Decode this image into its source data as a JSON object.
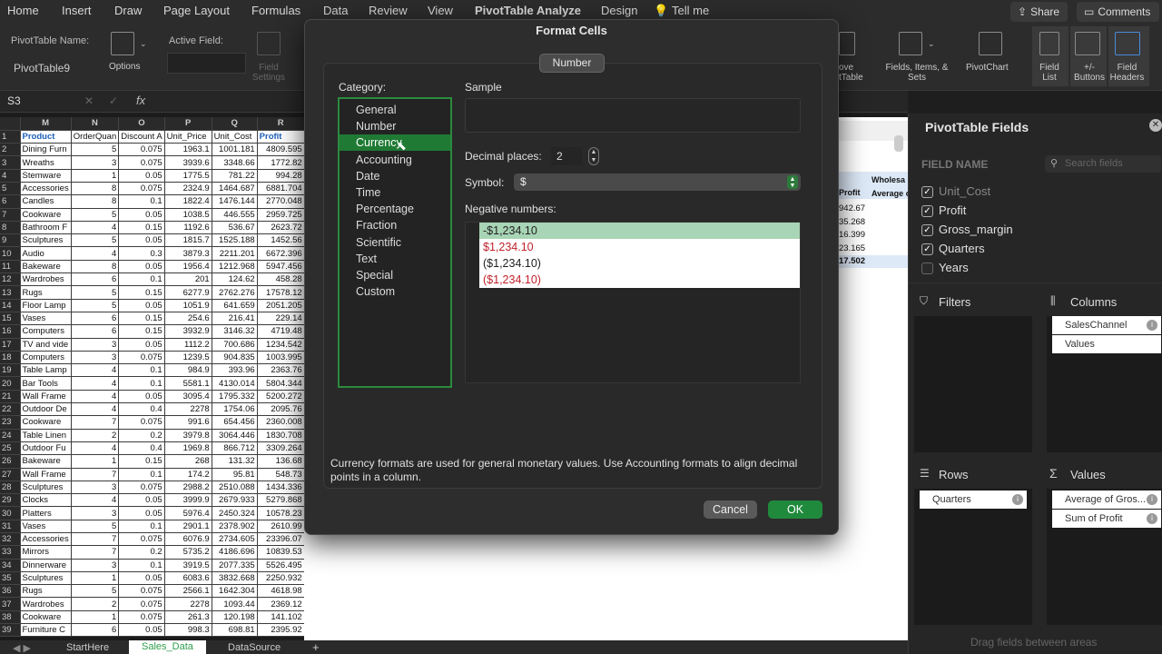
{
  "menu": {
    "items": [
      "Home",
      "Insert",
      "Draw",
      "Page Layout",
      "Formulas",
      "Data",
      "Review",
      "View",
      "PivotTable Analyze",
      "Design",
      "Tell me"
    ],
    "share": "Share",
    "comments": "Comments"
  },
  "ribbon": {
    "pt_name_label": "PivotTable Name:",
    "pt_name_value": "PivotTable9",
    "options": "Options",
    "active_field_label": "Active Field:",
    "field_settings": "Field Settings",
    "move_pt": "ove tTable",
    "fields_items_sets": "Fields, Items, & Sets",
    "pivotchart": "PivotChart",
    "field_list": "Field List",
    "plus_minus": "+/- Buttons",
    "field_headers": "Field Headers"
  },
  "formula_bar": {
    "cell_ref": "S3",
    "fx": "fx",
    "cancel": "✕",
    "confirm": "✓"
  },
  "sheet": {
    "col_headers": [
      "M",
      "N",
      "O",
      "P",
      "Q",
      "R"
    ],
    "header_row": [
      "Product",
      "OrderQuan",
      "Discount A",
      "Unit_Price",
      "Unit_Cost",
      "Profit"
    ],
    "rows": [
      [
        "2",
        "Dining Furn",
        "5",
        "0.075",
        "1963.1",
        "1001.181",
        "4809.595"
      ],
      [
        "3",
        "Wreaths",
        "3",
        "0.075",
        "3939.6",
        "3348.66",
        "1772.82"
      ],
      [
        "4",
        "Stemware",
        "1",
        "0.05",
        "1775.5",
        "781.22",
        "994.28"
      ],
      [
        "5",
        "Accessories",
        "8",
        "0.075",
        "2324.9",
        "1464.687",
        "6881.704"
      ],
      [
        "6",
        "Candles",
        "8",
        "0.1",
        "1822.4",
        "1476.144",
        "2770.048"
      ],
      [
        "7",
        "Cookware",
        "5",
        "0.05",
        "1038.5",
        "446.555",
        "2959.725"
      ],
      [
        "8",
        "Bathroom F",
        "4",
        "0.15",
        "1192.6",
        "536.67",
        "2623.72"
      ],
      [
        "9",
        "Sculptures",
        "5",
        "0.05",
        "1815.7",
        "1525.188",
        "1452.56"
      ],
      [
        "10",
        "Audio",
        "4",
        "0.3",
        "3879.3",
        "2211.201",
        "6672.396"
      ],
      [
        "11",
        "Bakeware",
        "8",
        "0.05",
        "1956.4",
        "1212.968",
        "5947.456"
      ],
      [
        "12",
        "Wardrobes",
        "6",
        "0.1",
        "201",
        "124.62",
        "458.28"
      ],
      [
        "13",
        "Rugs",
        "5",
        "0.15",
        "6277.9",
        "2762.276",
        "17578.12"
      ],
      [
        "14",
        "Floor Lamp",
        "5",
        "0.05",
        "1051.9",
        "641.659",
        "2051.205"
      ],
      [
        "15",
        "Vases",
        "6",
        "0.15",
        "254.6",
        "216.41",
        "229.14"
      ],
      [
        "16",
        "Computers",
        "6",
        "0.15",
        "3932.9",
        "3146.32",
        "4719.48"
      ],
      [
        "17",
        "TV and vide",
        "3",
        "0.05",
        "1112.2",
        "700.686",
        "1234.542"
      ],
      [
        "18",
        "Computers",
        "3",
        "0.075",
        "1239.5",
        "904.835",
        "1003.995"
      ],
      [
        "19",
        "Table Lamp",
        "4",
        "0.1",
        "984.9",
        "393.96",
        "2363.76"
      ],
      [
        "20",
        "Bar Tools",
        "4",
        "0.1",
        "5581.1",
        "4130.014",
        "5804.344"
      ],
      [
        "21",
        "Wall Frame",
        "4",
        "0.05",
        "3095.4",
        "1795.332",
        "5200.272"
      ],
      [
        "22",
        "Outdoor De",
        "4",
        "0.4",
        "2278",
        "1754.06",
        "2095.76"
      ],
      [
        "23",
        "Cookware",
        "7",
        "0.075",
        "991.6",
        "654.456",
        "2360.008"
      ],
      [
        "24",
        "Table Linen",
        "2",
        "0.2",
        "3979.8",
        "3064.446",
        "1830.708"
      ],
      [
        "25",
        "Outdoor Fu",
        "4",
        "0.4",
        "1969.8",
        "866.712",
        "3309.264"
      ],
      [
        "26",
        "Bakeware",
        "1",
        "0.15",
        "268",
        "131.32",
        "136.68"
      ],
      [
        "27",
        "Wall Frame",
        "7",
        "0.1",
        "174.2",
        "95.81",
        "548.73"
      ],
      [
        "28",
        "Sculptures",
        "3",
        "0.075",
        "2988.2",
        "2510.088",
        "1434.336"
      ],
      [
        "29",
        "Clocks",
        "4",
        "0.05",
        "3999.9",
        "2679.933",
        "5279.868"
      ],
      [
        "30",
        "Platters",
        "3",
        "0.05",
        "5976.4",
        "2450.324",
        "10578.23"
      ],
      [
        "31",
        "Vases",
        "5",
        "0.1",
        "2901.1",
        "2378.902",
        "2610.99"
      ],
      [
        "32",
        "Accessories",
        "7",
        "0.075",
        "6076.9",
        "2734.605",
        "23396.07"
      ],
      [
        "33",
        "Mirrors",
        "7",
        "0.2",
        "5735.2",
        "4186.696",
        "10839.53"
      ],
      [
        "34",
        "Dinnerware",
        "3",
        "0.1",
        "3919.5",
        "2077.335",
        "5526.495"
      ],
      [
        "35",
        "Sculptures",
        "1",
        "0.05",
        "6083.6",
        "3832.668",
        "2250.932"
      ],
      [
        "36",
        "Rugs",
        "5",
        "0.075",
        "2566.1",
        "1642.304",
        "4618.98"
      ],
      [
        "37",
        "Wardrobes",
        "2",
        "0.075",
        "2278",
        "1093.44",
        "2369.12"
      ],
      [
        "38",
        "Cookware",
        "1",
        "0.075",
        "261.3",
        "120.198",
        "141.102"
      ],
      [
        "39",
        "Furniture C",
        "6",
        "0.05",
        "998.3",
        "698.81",
        "2395.92"
      ]
    ],
    "right_header_profit": "Profit",
    "right_header_wholesale": "Wholesa",
    "right_header_average": "Average o",
    "right_values": [
      "942.67",
      "35.268",
      "16.399",
      "23.165",
      "17.502"
    ]
  },
  "sheet_tabs": [
    "StartHere",
    "Sales_Data",
    "DataSource",
    "+"
  ],
  "pivot": {
    "title": "PivotTable Fields",
    "field_name": "FIELD NAME",
    "search_placeholder": "Search fields",
    "fields": [
      {
        "name": "Unit_Cost",
        "checked": true
      },
      {
        "name": "Profit",
        "checked": true
      },
      {
        "name": "Gross_margin",
        "checked": true
      },
      {
        "name": "Quarters",
        "checked": true
      },
      {
        "name": "Years",
        "checked": false
      }
    ],
    "filters": "Filters",
    "columns": "Columns",
    "columns_items": [
      "SalesChannel",
      "Values"
    ],
    "rows": "Rows",
    "rows_items": [
      "Quarters"
    ],
    "values": "Values",
    "values_items": [
      "Average of Gros...",
      "Sum of Profit"
    ],
    "drag_hint": "Drag fields between areas"
  },
  "dialog": {
    "title": "Format Cells",
    "tab": "Number",
    "category_label": "Category:",
    "categories": [
      "General",
      "Number",
      "Currency",
      "Accounting",
      "Date",
      "Time",
      "Percentage",
      "Fraction",
      "Scientific",
      "Text",
      "Special",
      "Custom"
    ],
    "selected_category": "Currency",
    "sample_label": "Sample",
    "decimal_label": "Decimal places:",
    "decimal_value": "2",
    "symbol_label": "Symbol:",
    "symbol_value": "$",
    "negative_label": "Negative numbers:",
    "negative_options": [
      "-$1,234.10",
      "$1,234.10",
      "($1,234.10)",
      "($1,234.10)"
    ],
    "description": "Currency formats are used for general monetary values.  Use Accounting formats to align decimal points in a column.",
    "cancel": "Cancel",
    "ok": "OK"
  }
}
